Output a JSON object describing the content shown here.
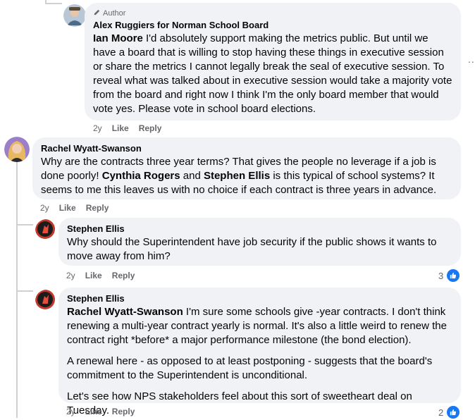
{
  "comments": [
    {
      "badge": "Author",
      "name": "Alex Ruggiers for Norman School Board",
      "mention": "Ian Moore",
      "text": " I'd absolutely support making the metrics public. But until we have a board that is willing to stop having these things in executive session or share the metrics I cannot legally break the seal of executive session. To reveal what was talked about in executive session would take a majority vote from the board and right now I think I'm the only board member that would vote yes. Please vote in school board elections.",
      "time": "2y",
      "like": "Like",
      "reply": "Reply"
    },
    {
      "name": "Rachel Wyatt-Swanson",
      "text_a": "Why are the contracts three year terms? That gives the people no leverage if a job is done poorly! ",
      "mention_a": "Cynthia Rogers",
      "text_b": " and ",
      "mention_b": "Stephen Ellis",
      "text_c": " is this typical of school systems? It seems to me this leaves us with no choice if each contract is three years in advance.",
      "time": "2y",
      "like": "Like",
      "reply": "Reply"
    },
    {
      "name": "Stephen Ellis",
      "text": "Why should the Superintendent have job security if the public shows it wants to move away from him?",
      "time": "2y",
      "like": "Like",
      "reply": "Reply",
      "reaction_count": "3"
    },
    {
      "name": "Stephen Ellis",
      "mention": "Rachel Wyatt-Swanson",
      "text_p1": " I'm sure some schools give -year contracts. I don't think renewing a multi-year contract yearly is normal. It's also a little weird to renew the contract right *before* a major performance milestone (the bond election).",
      "text_p2": "A renewal here - as opposed to at least postponing - suggests that the board's commitment to the Superintendent is unconditional.",
      "text_p3": "Let's see how NPS stakeholders feel about this sort of sweetheart deal on Tuesday.",
      "time": "2y",
      "like": "Like",
      "reply": "Reply",
      "reaction_count": "2"
    }
  ],
  "more_options": "..",
  "colors": {
    "accent": "#1877f2",
    "bubble": "#f0f2f5",
    "meta": "#65676b",
    "line": "#ced0d4"
  }
}
